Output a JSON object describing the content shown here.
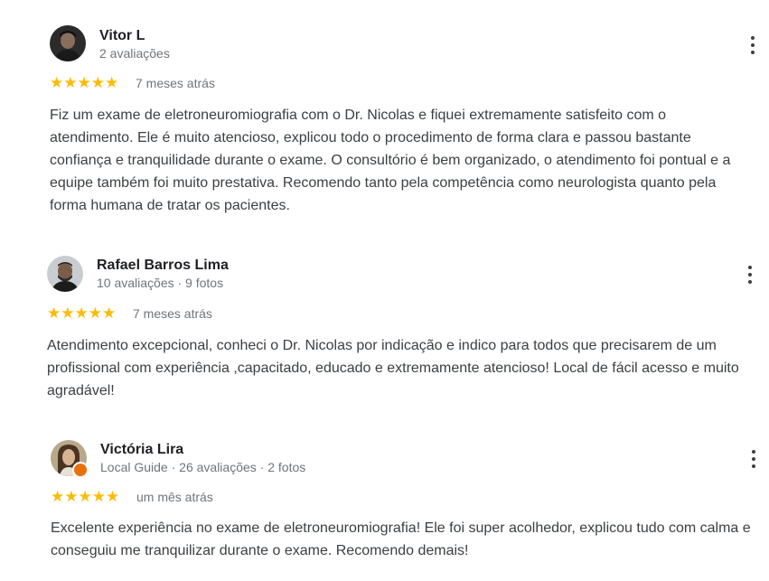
{
  "reviews": [
    {
      "author": "Vitor L",
      "meta": "2 avaliações",
      "rating": 5,
      "stars": "★★★★★",
      "date": "7 meses atrás",
      "text": "Fiz um exame de eletroneuromiografia com o Dr. Nicolas e fiquei extremamente satisfeito com o atendimento. Ele é muito atencioso, explicou todo o procedimento de forma clara e passou bastante confiança e tranquilidade durante o exame. O consultório é bem organizado, o atendimento foi pontual e a equipe também foi muito prestativa. Recomendo tanto pela competência como neurologista quanto pela forma humana de tratar os pacientes."
    },
    {
      "author": "Rafael Barros Lima",
      "meta": "10 avaliações · 9 fotos",
      "rating": 5,
      "stars": "★★★★★",
      "date": "7 meses atrás",
      "text": "Atendimento excepcional, conheci o Dr. Nicolas por indicação e indico para todos que precisarem de um profissional com experiência ,capacitado, educado e extremamente atencioso! Local de fácil acesso e muito agradável!"
    },
    {
      "author": "Victória Lira",
      "meta": "Local Guide · 26 avaliações · 2 fotos",
      "rating": 5,
      "stars": "★★★★★",
      "date": "um mês atrás",
      "text": "Excelente experiência no exame de eletroneuromiografia! Ele foi super acolhedor, explicou tudo com calma e conseguiu me tranquilizar durante o exame. Recomendo demais!"
    }
  ],
  "colors": {
    "star": "#fbbc04",
    "meta": "#70757a",
    "text": "#3c4043",
    "author": "#202124",
    "local_guide_badge": "#e8710a"
  },
  "icons": {
    "menu": "more-vert-icon",
    "star": "star-icon",
    "badge": "local-guide-badge-icon"
  }
}
